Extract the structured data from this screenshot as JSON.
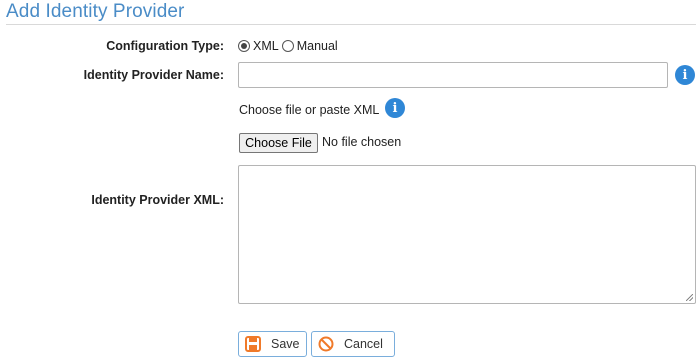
{
  "page": {
    "title": "Add Identity Provider"
  },
  "form": {
    "configuration_type": {
      "label": "Configuration Type:",
      "options": [
        "XML",
        "Manual"
      ],
      "selected": "XML"
    },
    "provider_name": {
      "label": "Identity Provider Name:",
      "value": "",
      "info_icon": "info-icon"
    },
    "file_picker": {
      "hint": "Choose file or paste XML",
      "button_label": "Choose File",
      "status": "No file chosen"
    },
    "provider_xml": {
      "label": "Identity Provider XML:",
      "value": ""
    }
  },
  "actions": {
    "save_label": "Save",
    "save_icon": "floppy-disk-icon",
    "cancel_label": "Cancel",
    "cancel_icon": "cancel-circle-icon"
  },
  "colors": {
    "title": "#4a8cc7",
    "info_icon": "#2f87d6",
    "button_border": "#7aaedc",
    "icon_accent": "#f07a2a"
  }
}
